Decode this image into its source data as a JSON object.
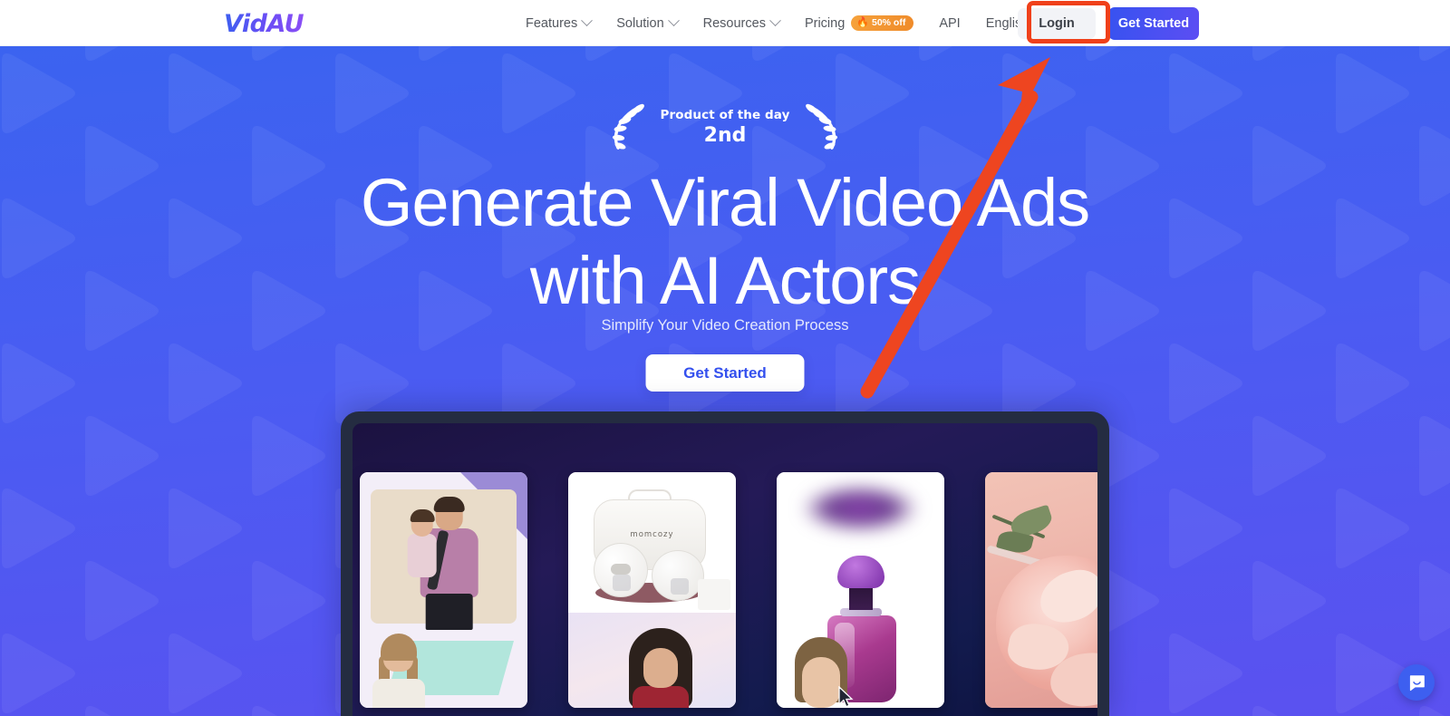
{
  "site": {
    "brand": "VidAU"
  },
  "nav": {
    "items": [
      {
        "label": "Features",
        "has_dropdown": true,
        "icon": "chevron-down-icon"
      },
      {
        "label": "Solution",
        "has_dropdown": true,
        "icon": "chevron-down-icon"
      },
      {
        "label": "Resources",
        "has_dropdown": true,
        "icon": "chevron-down-icon"
      }
    ],
    "pricing": {
      "label": "Pricing",
      "badge": "50% off",
      "badge_icon": "flame-icon"
    },
    "api": {
      "label": "API"
    },
    "language": {
      "label": "English",
      "icon": "chevron-down-icon"
    },
    "login": {
      "label": "Login"
    },
    "get_started": {
      "label": "Get Started"
    }
  },
  "hero": {
    "badge": {
      "top": "Product of the day",
      "rank": "2nd",
      "icon": "laurel-wreath-icon"
    },
    "title_line1": "Generate Viral Video Ads",
    "title_line2": "with AI Actors",
    "subtitle": "Simplify Your Video Creation Process",
    "cta": "Get Started"
  },
  "showcase": {
    "cards": [
      {
        "name": "family-carrier-ad"
      },
      {
        "name": "momcozy-breast-pump-ad",
        "brand": "momcozy"
      },
      {
        "name": "perfume-bottle-ad"
      },
      {
        "name": "rose-beauty-ad"
      }
    ]
  },
  "chat": {
    "icon": "chat-bubble-icon"
  },
  "annotations": {
    "highlight_target": "login-button",
    "arrow": "red-arrow-pointing-to-login",
    "color": "#f0401a"
  },
  "colors": {
    "brand_blue": "#3d5ff0",
    "hero_gradient_top": "#3b63f0",
    "hero_gradient_bottom": "#5b51f0",
    "accent_orange": "#ef8b2a",
    "annotation_red": "#f0401a",
    "laptop_bezel": "#242c41"
  }
}
